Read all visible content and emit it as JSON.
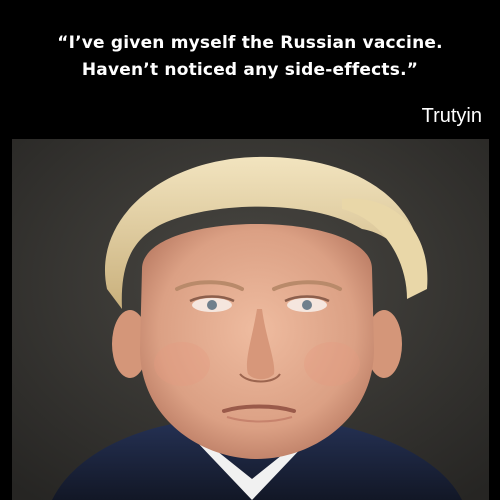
{
  "quote": {
    "line1": "“I’ve given myself the Russian vaccine.",
    "line2": "Haven’t noticed any side-effects.”"
  },
  "credit": "Trutyin",
  "colors": {
    "background": "#000000",
    "text": "#ffffff",
    "photo_background": "#3a3936",
    "hair": "#dcc89a",
    "skin": "#e3a98d",
    "suit": "#1b2236",
    "shirt": "#f1f1f1"
  },
  "photo": {
    "description_icon": "portrait-photo"
  }
}
